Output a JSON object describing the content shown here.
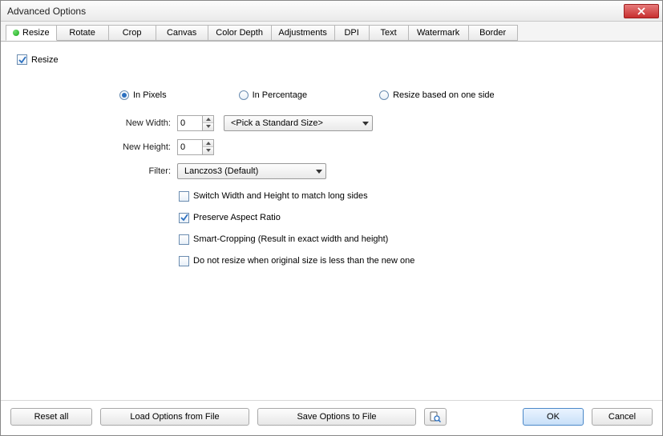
{
  "window": {
    "title": "Advanced Options"
  },
  "tabs": [
    {
      "label": "Resize",
      "active": true
    },
    {
      "label": "Rotate"
    },
    {
      "label": "Crop"
    },
    {
      "label": "Canvas"
    },
    {
      "label": "Color Depth"
    },
    {
      "label": "Adjustments"
    },
    {
      "label": "DPI"
    },
    {
      "label": "Text"
    },
    {
      "label": "Watermark"
    },
    {
      "label": "Border"
    }
  ],
  "resize": {
    "enable_label": "Resize",
    "enable_checked": true,
    "mode": {
      "pixels": "In Pixels",
      "percent": "In Percentage",
      "oneside": "Resize based on one side",
      "selected": "pixels"
    },
    "new_width_label": "New Width:",
    "new_width_value": "0",
    "new_height_label": "New Height:",
    "new_height_value": "0",
    "standard_size_label": "<Pick a Standard Size>",
    "filter_label": "Filter:",
    "filter_value": "Lanczos3 (Default)",
    "opts": {
      "switch_wh": {
        "label": "Switch Width and Height to match long sides",
        "checked": false
      },
      "preserve_ar": {
        "label": "Preserve Aspect Ratio",
        "checked": true
      },
      "smart_crop": {
        "label": "Smart-Cropping (Result in exact width and height)",
        "checked": false
      },
      "no_upscale": {
        "label": "Do not resize when original size is less than the new one",
        "checked": false
      }
    }
  },
  "buttons": {
    "reset_all": "Reset all",
    "load_file": "Load Options from File",
    "save_file": "Save Options to File",
    "ok": "OK",
    "cancel": "Cancel"
  }
}
